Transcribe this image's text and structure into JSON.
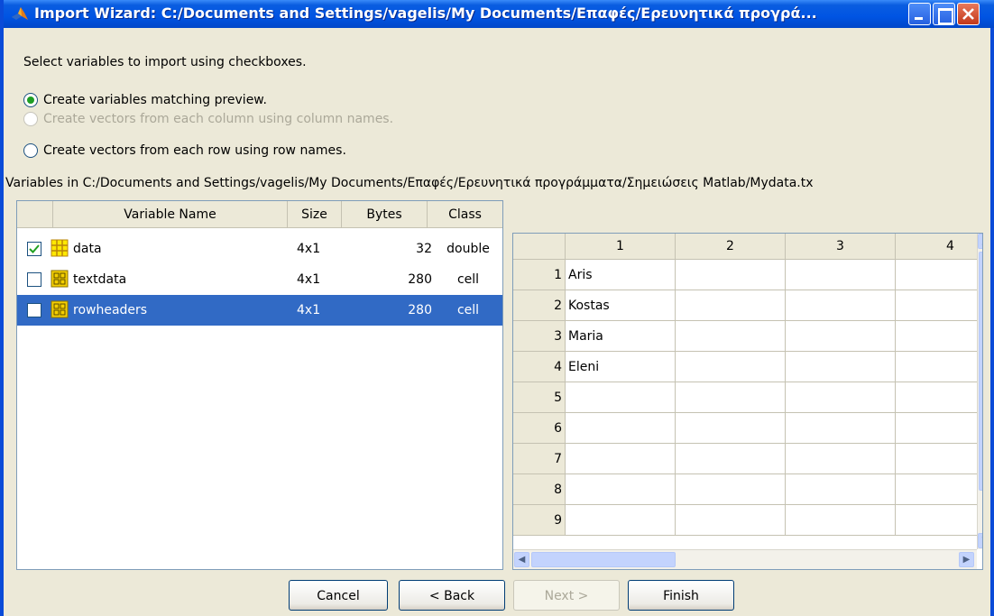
{
  "window": {
    "title": "Import Wizard: C:/Documents and Settings/vagelis/My Documents/Επαφές/Ερευνητικά προγρά...",
    "icon": "matlab-logo-icon"
  },
  "instructions": "Select variables to import using checkboxes.",
  "options": [
    {
      "label": "Create variables matching preview.",
      "selected": true,
      "enabled": true
    },
    {
      "label": "Create vectors from each column using column names.",
      "selected": false,
      "enabled": false
    },
    {
      "label": "Create vectors from each row using row names.",
      "selected": false,
      "enabled": true
    }
  ],
  "path_label": "Variables in C:/Documents and Settings/vagelis/My Documents/Επαφές/Ερευνητικά προγράμματα/Σημειώσεις Matlab/Mydata.tx",
  "variables": {
    "headers": {
      "name": "Variable Name",
      "size": "Size",
      "bytes": "Bytes",
      "class": "Class"
    },
    "rows": [
      {
        "checked": true,
        "icon": "matrix-grid-icon",
        "name": "data",
        "size": "4x1",
        "bytes": "32",
        "class": "double",
        "selected": false
      },
      {
        "checked": false,
        "icon": "cell-array-icon",
        "name": "textdata",
        "size": "4x1",
        "bytes": "280",
        "class": "cell",
        "selected": false
      },
      {
        "checked": false,
        "icon": "cell-array-icon",
        "name": "rowheaders",
        "size": "4x1",
        "bytes": "280",
        "class": "cell",
        "selected": true
      }
    ]
  },
  "preview": {
    "column_headers": [
      "1",
      "2",
      "3",
      "4"
    ],
    "row_headers": [
      "1",
      "2",
      "3",
      "4",
      "5",
      "6",
      "7",
      "8",
      "9"
    ],
    "cells": [
      [
        "Aris",
        "",
        "",
        ""
      ],
      [
        "Kostas",
        "",
        "",
        ""
      ],
      [
        "Maria",
        "",
        "",
        ""
      ],
      [
        "Eleni",
        "",
        "",
        ""
      ],
      [
        "",
        "",
        "",
        ""
      ],
      [
        "",
        "",
        "",
        ""
      ],
      [
        "",
        "",
        "",
        ""
      ],
      [
        "",
        "",
        "",
        ""
      ],
      [
        "",
        "",
        "",
        ""
      ]
    ]
  },
  "buttons": {
    "cancel": "Cancel",
    "back": "< Back",
    "next": "Next >",
    "finish": "Finish"
  },
  "colors": {
    "titlebar": "#0054E3",
    "selection": "#316AC5",
    "window_bg": "#ECE9D8"
  }
}
